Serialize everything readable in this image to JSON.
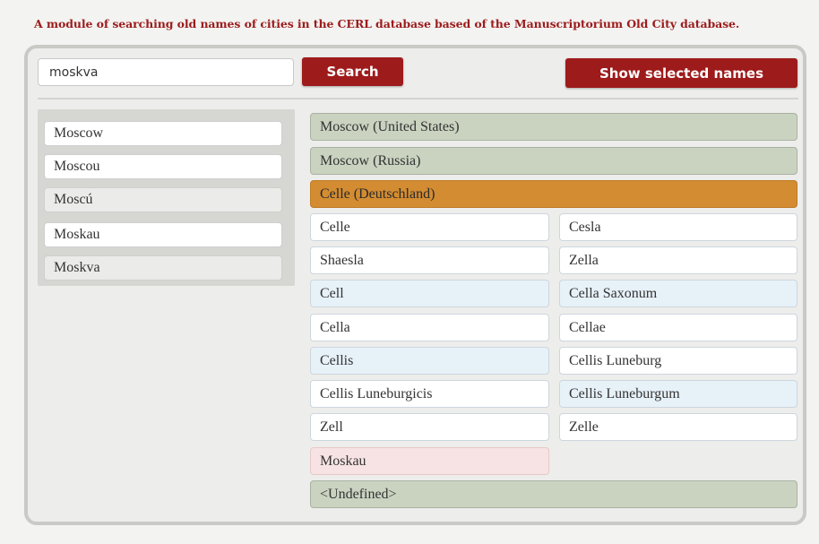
{
  "heading": "A module of searching old names of cities in the CERL database based of the Manuscriptorium Old City database.",
  "search": {
    "value": "moskva",
    "button_label": "Search"
  },
  "show_selected_label": "Show selected names",
  "left_names": [
    "Moscow",
    "Moscou",
    "Moscú",
    "Moskau",
    "Moskva"
  ],
  "groups": {
    "moscow_us": "Moscow (United States)",
    "moscow_ru": "Moscow (Russia)",
    "celle": "Celle (Deutschland)",
    "undefined": "<Undefined>"
  },
  "variants": [
    [
      "Celle",
      "Cesla"
    ],
    [
      "Shaesla",
      "Zella"
    ],
    [
      "Cell",
      "Cella Saxonum"
    ],
    [
      "Cella",
      "Cellae"
    ],
    [
      "Cellis",
      "Cellis Luneburg"
    ],
    [
      "Cellis Luneburgicis",
      "Cellis Luneburgum"
    ],
    [
      "Zell",
      "Zelle"
    ]
  ],
  "undefined_variant": "Moskau",
  "colors": {
    "brand_red": "#9e1b1b",
    "group_green": "#c9d3c0",
    "selected_orange": "#d38c31",
    "variant_blue": "#e7f1f8",
    "variant_pink": "#f7e3e3"
  }
}
